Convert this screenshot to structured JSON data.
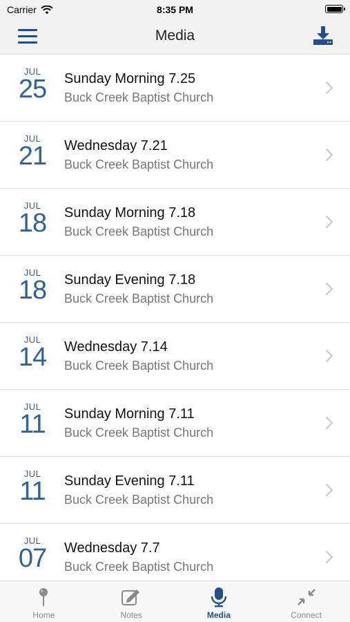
{
  "status_bar": {
    "carrier": "Carrier",
    "time": "8:35 PM"
  },
  "header": {
    "title": "Media"
  },
  "media_items": [
    {
      "month": "JUL",
      "day": "25",
      "title": "Sunday Morning 7.25",
      "subtitle": "Buck Creek Baptist Church"
    },
    {
      "month": "JUL",
      "day": "21",
      "title": "Wednesday 7.21",
      "subtitle": "Buck Creek Baptist Church"
    },
    {
      "month": "JUL",
      "day": "18",
      "title": "Sunday Morning 7.18",
      "subtitle": "Buck Creek Baptist Church"
    },
    {
      "month": "JUL",
      "day": "18",
      "title": "Sunday Evening 7.18",
      "subtitle": "Buck Creek Baptist Church"
    },
    {
      "month": "JUL",
      "day": "14",
      "title": "Wednesday 7.14",
      "subtitle": "Buck Creek Baptist Church"
    },
    {
      "month": "JUL",
      "day": "11",
      "title": "Sunday Morning 7.11",
      "subtitle": "Buck Creek Baptist Church"
    },
    {
      "month": "JUL",
      "day": "11",
      "title": "Sunday Evening 7.11",
      "subtitle": "Buck Creek Baptist Church"
    },
    {
      "month": "JUL",
      "day": "07",
      "title": "Wednesday 7.7",
      "subtitle": "Buck Creek Baptist Church"
    }
  ],
  "tabs": [
    {
      "label": "Home",
      "icon": "pin-icon",
      "active": false
    },
    {
      "label": "Notes",
      "icon": "notes-icon",
      "active": false
    },
    {
      "label": "Media",
      "icon": "microphone-icon",
      "active": true
    },
    {
      "label": "Connect",
      "icon": "compress-icon",
      "active": false
    }
  ],
  "colors": {
    "accent": "#1f4f8f",
    "date": "#2d6399",
    "inactive": "#8a8a8a",
    "bar": "#f2f2f2"
  }
}
